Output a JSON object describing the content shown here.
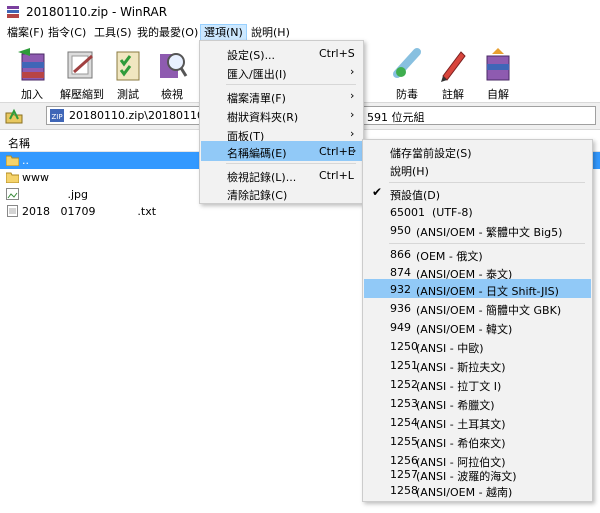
{
  "window": {
    "title": "20180110.zip - WinRAR"
  },
  "menubar": [
    "檔案(F)",
    "指令(C)",
    "工具(S)",
    "我的最愛(O)",
    "選項(N)",
    "說明(H)"
  ],
  "toolbar": {
    "buttons": [
      "加入",
      "解壓縮到",
      "測試",
      "檢視",
      "防毒",
      "註解",
      "自解"
    ]
  },
  "address": {
    "path": "20180110.zip\\20180110",
    "info": "591 位元組"
  },
  "filelist": {
    "column_name": "名稱",
    "rows": [
      {
        "name": ".."
      },
      {
        "name": "www"
      },
      {
        "name": "             .jpg"
      },
      {
        "name": "2018   01709            .txt"
      }
    ]
  },
  "options_menu": {
    "items": [
      {
        "label": "設定(S)...",
        "shortcut": "Ctrl+S"
      },
      {
        "label": "匯入/匯出(I)",
        "shortcut": ""
      },
      {
        "label": "檔案清單(F)",
        "shortcut": ""
      },
      {
        "label": "樹狀資料夾(R)",
        "shortcut": ""
      },
      {
        "label": "面板(T)",
        "shortcut": ""
      },
      {
        "label": "名稱編碼(E)",
        "shortcut": "Ctrl+E"
      },
      {
        "label": "檢視記錄(L)...",
        "shortcut": "Ctrl+L"
      },
      {
        "label": "清除記錄(C)",
        "shortcut": ""
      }
    ]
  },
  "encoding_menu": {
    "top": [
      "儲存當前設定(S)",
      "說明(H)",
      "預設值(D)"
    ],
    "items": [
      {
        "code": "65001",
        "name": "(UTF-8)"
      },
      {
        "code": "950",
        "name": "(ANSI/OEM - 繁體中文 Big5)"
      },
      {
        "code": "866",
        "name": "(OEM - 俄文)"
      },
      {
        "code": "874",
        "name": "(ANSI/OEM - 泰文)"
      },
      {
        "code": "932",
        "name": "(ANSI/OEM - 日文 Shift-JIS)"
      },
      {
        "code": "936",
        "name": "(ANSI/OEM - 簡體中文 GBK)"
      },
      {
        "code": "949",
        "name": "(ANSI/OEM - 韓文)"
      },
      {
        "code": "1250",
        "name": "(ANSI - 中歐)"
      },
      {
        "code": "1251",
        "name": "(ANSI - 斯拉夫文)"
      },
      {
        "code": "1252",
        "name": "(ANSI - 拉丁文 I)"
      },
      {
        "code": "1253",
        "name": "(ANSI - 希臘文)"
      },
      {
        "code": "1254",
        "name": "(ANSI - 土耳其文)"
      },
      {
        "code": "1255",
        "name": "(ANSI - 希伯來文)"
      },
      {
        "code": "1256",
        "name": "(ANSI - 阿拉伯文)"
      },
      {
        "code": "1257",
        "name": "(ANSI - 波羅的海文)"
      },
      {
        "code": "1258",
        "name": "(ANSI/OEM - 越南)"
      }
    ]
  },
  "colors": {
    "selection": "#3399ff",
    "menu_highlight": "#91c9f7",
    "menu_bg": "#f2f2f2"
  }
}
